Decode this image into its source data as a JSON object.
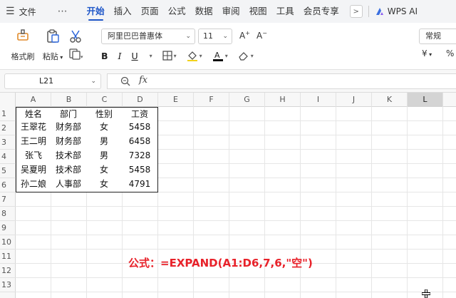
{
  "menubar": {
    "file_label": "文件",
    "more_label": "⋯",
    "tabs": [
      "开始",
      "插入",
      "页面",
      "公式",
      "数据",
      "审阅",
      "视图",
      "工具",
      "会员专享"
    ],
    "active_tab": "开始",
    "ai_label": "WPS AI"
  },
  "toolbar": {
    "format_painter_label": "格式刷",
    "paste_label": "粘贴",
    "font_name": "阿里巴巴普惠体",
    "font_size": "11",
    "number_format": "常规",
    "bold": "B",
    "italic": "I",
    "underline": "U",
    "currency": "¥",
    "percent": "%"
  },
  "formula_bar": {
    "cell_ref": "L21",
    "fx": "fx",
    "content": ""
  },
  "grid": {
    "columns": [
      "A",
      "B",
      "C",
      "D",
      "E",
      "F",
      "G",
      "H",
      "I",
      "J",
      "K",
      "L"
    ],
    "selected_column": "L",
    "rows": [
      "1",
      "2",
      "3",
      "4",
      "5",
      "6",
      "7",
      "8",
      "9",
      "10",
      "11",
      "12",
      "13"
    ],
    "table": {
      "headers": [
        "姓名",
        "部门",
        "性别",
        "工资"
      ],
      "rows": [
        [
          "王翠花",
          "财务部",
          "女",
          "5458"
        ],
        [
          "王二明",
          "财务部",
          "男",
          "6458"
        ],
        [
          "张飞",
          "技术部",
          "男",
          "7328"
        ],
        [
          "吴夏明",
          "技术部",
          "女",
          "5458"
        ],
        [
          "孙二娘",
          "人事部",
          "女",
          "4791"
        ]
      ]
    }
  },
  "annotation": {
    "text": "公式：=EXPAND(A1:D6,7,6,\"空\")",
    "color": "#e8222a"
  },
  "colors": {
    "accent": "#1e56c8",
    "menubar_bg": "#f3f4f6"
  }
}
